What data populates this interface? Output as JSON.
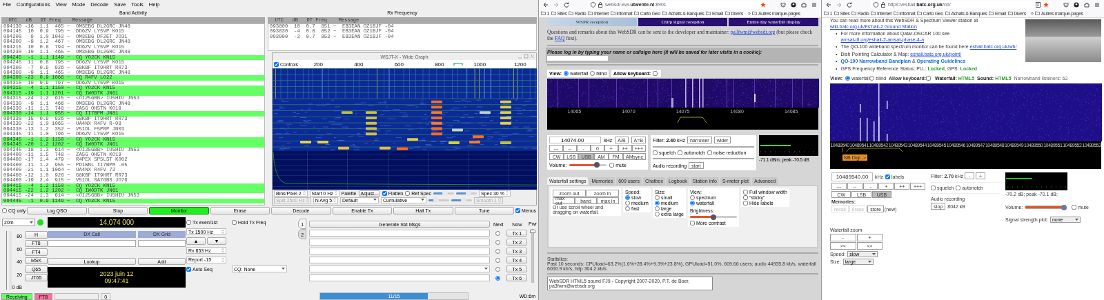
{
  "wsjtx": {
    "menu": [
      "File",
      "Configurations",
      "View",
      "Mode",
      "Decode",
      "Save",
      "Tools",
      "Help"
    ],
    "band_activity": {
      "title": "Band Activity",
      "header": "  UTC   dB   DT Freq    Message",
      "rows": [
        {
          "text": "094130 -16  1.1  465 ~  OM3EBG DL2GRC JN48",
          "highlighted": false
        },
        {
          "text": "094145  10  0.9  795 ~  DD6ZV LY5VP KO15",
          "highlighted": false
        },
        {
          "text": "094200   9  1.0 1042 ~  OM3EBG DF2ET JO31",
          "highlighted": false
        },
        {
          "text": "094200  -9  1.2  467 ~  OM3EBG DL2GRC JN48",
          "highlighted": false
        },
        {
          "text": "094215  10  0.8  794 ~  DD6ZV LY5VP KO15",
          "highlighted": false
        },
        {
          "text": "094230 -10  1.1  465 ~  OM3EBG DL2GRC JN48",
          "highlighted": false
        },
        {
          "text": "094245  -1  1.1 1149 ~  CQ YO2CK KN15",
          "highlighted": true
        },
        {
          "text": "094245  11  0.8  795 ~  DD6ZV LY5VP KO15",
          "highlighted": false
        },
        {
          "text": "094300  -7  0.9  926 ~  G8KBF IT9HRT RR73",
          "highlighted": false
        },
        {
          "text": "094300  -9  1.1  465 ~  OM3EBG DL2GRC JN48",
          "highlighted": false
        },
        {
          "text": "094300 -23  0.9 1066 ~  CQ R4FV LO22",
          "highlighted": true
        },
        {
          "text": "094315  10  0.9  797 ~  DD6ZV LY5VP KO15",
          "highlighted": false
        },
        {
          "text": "094315  -4  1.1 1150 ~  CQ YO2CK KN15",
          "highlighted": true
        },
        {
          "text": "094315 -19  1.1 1201 ~  CQ IW0DTK JN61",
          "highlighted": true
        },
        {
          "text": "094315 -24  1.2  615 ~  <OI25GBB> IU5HIU JN53",
          "highlighted": false
        },
        {
          "text": "094330  -9  1.1  466 ~  OM3EBG DL2GRC JN48",
          "highlighted": false
        },
        {
          "text": "094330 -11  1.3  748 ~  ZA5G OH5TN KO19",
          "highlighted": false
        },
        {
          "text": "094330 -14  1.1  955 ~  CQ II7BPM JN81",
          "highlighted": true
        },
        {
          "text": "094330 -15  0.9  926 ~  G8KBF IT9HRT RR73",
          "highlighted": false
        },
        {
          "text": "094330 -22  1.0 1065 ~  UA4NX R4FV R-08",
          "highlighted": false
        },
        {
          "text": "094330 -13  1.2  352 ~  V51DL F5PRP JN03",
          "highlighted": false
        },
        {
          "text": "094345  11  1.0  796 ~  DD6ZV LY5VP KO15",
          "highlighted": false
        },
        {
          "text": "094345  -1  1.2 1150 ~  CQ YO2CK KN15",
          "highlighted": true
        },
        {
          "text": "094345 -20  1.2 1202 ~  CQ IW0DTK JN61",
          "highlighted": true
        },
        {
          "text": "094345 -18  1.3  614 ~  <OI25GBB> IU5HIU JN53",
          "highlighted": false
        },
        {
          "text": "094400 -11  1.5  748 ~  ZA5G OH5TN KO19",
          "highlighted": false
        },
        {
          "text": "094400 -17  1.4  479 ~  R4PEX SP5LST KO02",
          "highlighted": false
        },
        {
          "text": "094400 -11  1.2  955 ~  PD1WNL II7BPM -05",
          "highlighted": false
        },
        {
          "text": "094400 -21  1.1 1064 ~  UA4NX R4FV 73",
          "highlighted": false
        },
        {
          "text": "094400 -12  1.0  926 ~  G8KBF IT9HRT RR73",
          "highlighted": false
        },
        {
          "text": "094400 -19  2.4  915 ~  V51DL SA7GBS JO76",
          "highlighted": false
        },
        {
          "text": "094415  -4  1.2 1150 ~  CQ YO2CK KN15",
          "highlighted": true
        },
        {
          "text": "094415 -22  1.2 1202 ~  CQ IW0DTK JN61",
          "highlighted": true
        },
        {
          "text": "094415 -24  1.3  614 ~  <OI25GBB> IU5HIU JN53",
          "highlighted": false
        },
        {
          "text": "094445  -1  0.9 1149 ~  CQ YO2CK KN15",
          "highlighted": true
        }
      ]
    },
    "rx_frequency": {
      "title": "Rx Frequency",
      "header": "  UTC   dB   DT Freq    Message",
      "rows": [
        {
          "text": "093800  10  0.7  851 ~  EB3EAN OZ1BJF -04",
          "highlighted": false
        },
        {
          "text": "093830  -4  0.8  852 ~  EB3EAN OZ1BJF -04",
          "highlighted": false
        },
        {
          "text": "093900  -2  0.7  852 ~  EB3EAN OZ1BJF -04",
          "highlighted": false
        }
      ]
    },
    "wide_graph": {
      "title": "WSJT-X - Wide Graph",
      "controls": {
        "label": "Controls",
        "checked": true
      },
      "ticks": [
        "200",
        "400",
        "600",
        "800",
        "1000",
        "1200"
      ],
      "settings": [
        [
          {
            "kind": "spin",
            "label": "Bins/Pixel  2",
            "disabled": false
          },
          {
            "kind": "spin",
            "label": "Start 0 Hz",
            "disabled": false
          },
          {
            "kind": "text",
            "label": "Palette"
          },
          {
            "kind": "button",
            "label": "Adjust..."
          },
          {
            "kind": "check",
            "label": "Flatten",
            "checked": true
          },
          {
            "kind": "check",
            "label": "Ref Spec",
            "checked": false
          },
          {
            "kind": "slider",
            "level": 0.55
          },
          {
            "kind": "slider",
            "level": 0.6
          },
          {
            "kind": "spin",
            "label": "Spec 30 %",
            "disabled": false
          }
        ],
        [
          {
            "kind": "spin",
            "label": "Split  2500 Hz",
            "disabled": true
          },
          {
            "kind": "spin",
            "label": "N Avg 5",
            "disabled": false
          },
          {
            "kind": "select",
            "label": "Default"
          },
          {
            "kind": "select",
            "label": "Cumulative"
          },
          {
            "kind": "slider",
            "level": 0.35
          },
          {
            "kind": "slider",
            "level": 0.6
          },
          {
            "kind": "spin",
            "label": "Smooth  1",
            "disabled": true
          }
        ]
      ]
    },
    "toolbar": [
      {
        "kind": "check",
        "label": "CQ only",
        "checked": false
      },
      {
        "kind": "button",
        "label": "Log QSO",
        "active": false
      },
      {
        "kind": "button",
        "label": "Stop",
        "active": false
      },
      {
        "kind": "button",
        "label": "Monitor",
        "active": true
      },
      {
        "kind": "button",
        "label": "Erase",
        "active": false
      },
      {
        "kind": "button",
        "label": "Decode",
        "active": false
      },
      {
        "kind": "button",
        "label": "Enable Tx",
        "active": false
      },
      {
        "kind": "button",
        "label": "Halt Tx",
        "active": false
      },
      {
        "kind": "button",
        "label": "Tune",
        "active": false
      },
      {
        "kind": "check",
        "label": "Menus",
        "checked": true
      }
    ],
    "band": "20m",
    "cat_ok": true,
    "frequency": "14,074 000",
    "meter": {
      "ticks": [
        "80",
        "60",
        "40",
        "20"
      ],
      "unit": "0 dB"
    },
    "modes": [
      "H",
      "FT8",
      "FT4",
      "MSK",
      "Q65",
      "JT65"
    ],
    "dx_call": "DX Call",
    "dx_grid": "DX Grid",
    "lookup": "Lookup",
    "add": "Add",
    "date": "2023 juin 12",
    "time": "09:47:41",
    "tx_even": {
      "label": "Tx even/1st",
      "checked": false
    },
    "hold_tx": {
      "label": "Hold Tx Freq",
      "checked": false
    },
    "tx_freq": "Tx  1500  Hz",
    "up": "▲",
    "down": "▼",
    "rx_freq": "Rx  853  Hz",
    "report": "Report -15",
    "auto_seq": {
      "label": "Auto Seq",
      "checked": true
    },
    "cq": "CQ: None",
    "tabs": [
      {
        "label": "1",
        "selected": true
      },
      {
        "label": "2",
        "selected": false
      }
    ],
    "generate": "Generate Std Msgs",
    "next": "Next",
    "now": "Now",
    "messages": [
      {
        "kind": "field",
        "selected": false,
        "button": "Tx 1"
      },
      {
        "kind": "field",
        "selected": false,
        "button": "Tx 2"
      },
      {
        "kind": "field",
        "selected": false,
        "button": "Tx 3"
      },
      {
        "kind": "field",
        "selected": false,
        "button": "Tx 4"
      },
      {
        "kind": "combo",
        "selected": false,
        "button": "Tx 5"
      },
      {
        "kind": "field",
        "selected": true,
        "button": "Tx 6"
      }
    ],
    "pwr": {
      "label": "Pwr",
      "level": 0.97
    },
    "status": [
      {
        "text": "Receiving",
        "color": "#66ff66"
      },
      {
        "text": "FT8",
        "color": "#ff6f9f"
      }
    ],
    "count": "0",
    "progress": {
      "label": "11/15",
      "level": 0.73
    },
    "wd": "WD:6m"
  },
  "websdr_a": {
    "url": "websdr.ewi.**utwente.nl**:8901",
    "bookmarks": [
      "1",
      "Sites",
      "Radio",
      "Internet",
      "Informat",
      "Carto Geo",
      "Achats & Banques",
      "Email",
      "Divers"
    ],
    "overflow": "»",
    "other_bookmarks": "Autres marque-pages",
    "banners": [
      "WSPR reception",
      "Chirp signal reception",
      "Entire day waterfall display"
    ],
    "contact": {
      "before": "Questions and remarks about this WebSDR can be sent to the developer and maintainer: ",
      "email": "pa3fwm@websdr.org",
      "middle": " (but please check the ",
      "faq": "FAQ",
      "after": " first)."
    },
    "login": "Please log in by typing your name or callsign here (it will be saved for later visits in a cookie):",
    "view": {
      "label": "View:",
      "options": [
        {
          "label": "waterfall",
          "selected": true
        },
        {
          "label": "blind",
          "selected": false
        }
      ]
    },
    "keyboard": {
      "label": "Allow keyboard:",
      "checked": false
    },
    "scale": [
      "14065",
      "14070",
      "14075",
      "14080",
      "14085"
    ],
    "frequency": "14074.00",
    "unit": "kHz",
    "vfo_buttons": [
      "A/B",
      "A=B"
    ],
    "steps": [
      "---",
      "--",
      "-",
      "0",
      "+",
      "++",
      "+++"
    ],
    "modes": [
      {
        "label": "CW",
        "selected": false
      },
      {
        "label": "LSB",
        "selected": false
      },
      {
        "label": "USB",
        "selected": true
      },
      {
        "label": "AM",
        "selected": false
      },
      {
        "label": "FM",
        "selected": false
      },
      {
        "label": "AMsync",
        "selected": false
      }
    ],
    "volume": {
      "label": "Volume:",
      "level": 0.74
    },
    "mute": {
      "label": "mute",
      "checked": false
    },
    "filter": {
      "text": "Filter: **2.40** kHz",
      "buttons": [
        "narrower",
        "wider"
      ]
    },
    "options": [
      {
        "label": "squelch",
        "checked": false
      },
      {
        "label": "autonotch",
        "checked": false
      },
      {
        "label": "noise reduction",
        "checked": false
      }
    ],
    "recording": {
      "label": "Audio recording",
      "button": "start"
    },
    "smeter": "-71.1 dBm; peak  -70.5 dB",
    "tabs": [
      {
        "label": "Waterfall settings",
        "selected": true
      },
      {
        "label": "Memories",
        "selected": false
      },
      {
        "label": "609 users",
        "selected": false
      },
      {
        "label": "Chatbox",
        "selected": false
      },
      {
        "label": "Logbook",
        "selected": false
      },
      {
        "label": "Station info",
        "selected": false
      },
      {
        "label": "S-meter plot",
        "selected": false
      },
      {
        "label": "Advanced",
        "selected": false
      }
    ],
    "zoom_buttons": [
      [
        "zoom out",
        "zoom in"
      ],
      [
        "max out",
        "band",
        "max in"
      ]
    ],
    "zoom_hint": "Or use scroll wheel and dragging on waterfall.",
    "speed": {
      "label": "Speed:",
      "options": [
        {
          "label": "slow",
          "selected": true
        },
        {
          "label": "medium",
          "selected": false
        },
        {
          "label": "fast",
          "selected": false
        }
      ]
    },
    "size": {
      "label": "Size:",
      "options": [
        {
          "label": "small",
          "selected": false
        },
        {
          "label": "medium",
          "selected": true
        },
        {
          "label": "large",
          "selected": false
        },
        {
          "label": "extra large",
          "selected": false
        }
      ]
    },
    "view_mode": {
      "label": "View:",
      "options": [
        {
          "label": "spectrum",
          "selected": false
        },
        {
          "label": "waterfall",
          "selected": true
        }
      ]
    },
    "brightness": {
      "label": "Brightness:",
      "level": 0.5
    },
    "contrast": {
      "label": "More contrast",
      "checked": false
    },
    "display_options": [
      {
        "label": "Full window width",
        "checked": false
      },
      {
        "label": "\"sticky\"",
        "checked": false
      },
      {
        "label": "Hide labels",
        "checked": false
      }
    ],
    "statistics_title": "Statistics:",
    "statistics": "Past 10 seconds: CPUload=63.2%(1.6%+28.4%+9.3%+23.8%), GPUload=51.0%, 609.66 users; audio 44935.8 kb/s, waterfall 6000.9 kb/s, http 304.2 kb/s",
    "footer": "WebSDR HTML5 sound FJ9 - Copyright 2007-2020, P.T. de Boer, pa3fwm@websdr.org"
  },
  "websdr_b": {
    "url": "https://eshail.**batc.org.uk**/nb/",
    "bookmarks": [
      "1",
      "Sites",
      "Radio",
      "Internet",
      "Informat",
      "Carto Geo",
      "Achats & Banques",
      "Email",
      "Divers"
    ],
    "overflow": "»",
    "other_bookmarks": "Autres marque-pages",
    "intro": {
      "before": "You can read more about this WebSDR & Spectrum Viewer station at",
      "link": "wiki.batc.org.uk/Es'hail-2 Ground Station"
    },
    "bullets": [
      {
        "marker": "•",
        "parts": [
          {
            "kind": "text",
            "text": "For more information about Qatar-OSCAR 100 see "
          },
          {
            "kind": "link",
            "text": "amsat-dl.org/eshail-2-amsat-phase-4-a"
          }
        ]
      },
      {
        "marker": "•",
        "parts": [
          {
            "kind": "text",
            "text": "The QO-100 wideband spectrum monitor can be found here "
          },
          {
            "kind": "link",
            "text": "eshail.batc.org.uk/wb/"
          }
        ]
      },
      {
        "marker": "•",
        "parts": [
          {
            "kind": "text",
            "text": "Dish Pointing Calculator & Map: "
          },
          {
            "kind": "link",
            "text": "eshail.batc.org.uk/point/"
          }
        ]
      },
      {
        "marker": "•",
        "parts": [
          {
            "kind": "strong_link",
            "text": "QO-100 Narrowband Bandplan"
          },
          {
            "kind": "text",
            "text": " & "
          },
          {
            "kind": "strong_link",
            "text": "Operating Guidelines"
          }
        ]
      },
      {
        "marker": "•",
        "parts": [
          {
            "kind": "text",
            "text": "GPS Frequency Reference Status: PLL: "
          },
          {
            "kind": "ok",
            "text": "Locked"
          },
          {
            "kind": "text",
            "text": ", GPS: "
          },
          {
            "kind": "ok",
            "text": "Locked"
          }
        ]
      }
    ],
    "view": {
      "label": "View:",
      "options": [
        {
          "label": "waterfall",
          "selected": true
        },
        {
          "label": "blind",
          "selected": false
        }
      ]
    },
    "keyboard": {
      "label": "Allow keyboard:",
      "checked": false
    },
    "waterfall_label": "Waterfall:",
    "waterfall_value": "HTML5",
    "sound_label": "Sound:",
    "sound_value": "HTML5",
    "listeners": "Narrowband listeners: 62",
    "scale": [
      "10489540",
      "10489541",
      "10489542",
      "10489543",
      "10489544",
      "10489545",
      "10489546",
      "10489547",
      "10489548",
      "10489549",
      "10489550",
      "10489551",
      "10489552",
      "10489553"
    ],
    "band_tag": "NB Digi ->",
    "frequency": "10489540.00",
    "unit": "kHz",
    "labels": {
      "label": "labels",
      "checked": true
    },
    "steps": [
      "---",
      "--",
      "-",
      "+",
      "++",
      "+++"
    ],
    "modes": [
      {
        "label": "CW",
        "selected": false
      },
      {
        "label": "LSB",
        "selected": false
      },
      {
        "label": "USB",
        "selected": true
      }
    ],
    "memories": {
      "label": "Memories:",
      "buttons": [
        {
          "label": "recall",
          "disabled": true
        },
        {
          "label": "erase",
          "disabled": true
        },
        {
          "label": "store",
          "disabled": false
        }
      ],
      "note": "(new)"
    },
    "filter": {
      "text": "Filter: **2.70** kHz",
      "buttons": [
        "-",
        "+"
      ]
    },
    "options": [
      {
        "label": "squelch",
        "checked": false
      },
      {
        "label": "autonotch",
        "checked": false
      }
    ],
    "recording": {
      "label": "Audio recording",
      "button": "stop",
      "size": "8042 kB"
    },
    "smeter": "-70.2 dB; peak  -70.1 dB;",
    "volume": {
      "label": "Volume:",
      "level": 0.96
    },
    "mute": {
      "label": "mute",
      "checked": false
    },
    "plot": {
      "label": "Signal strength plot:",
      "value": "none"
    },
    "wf_zoom": {
      "label": "Waterfall zoom",
      "buttons": [
        "-",
        "+",
        "><",
        "<>"
      ]
    },
    "speed": {
      "label": "Speed:",
      "value": "slow"
    },
    "size": {
      "label": "Size:",
      "value": "large"
    }
  }
}
